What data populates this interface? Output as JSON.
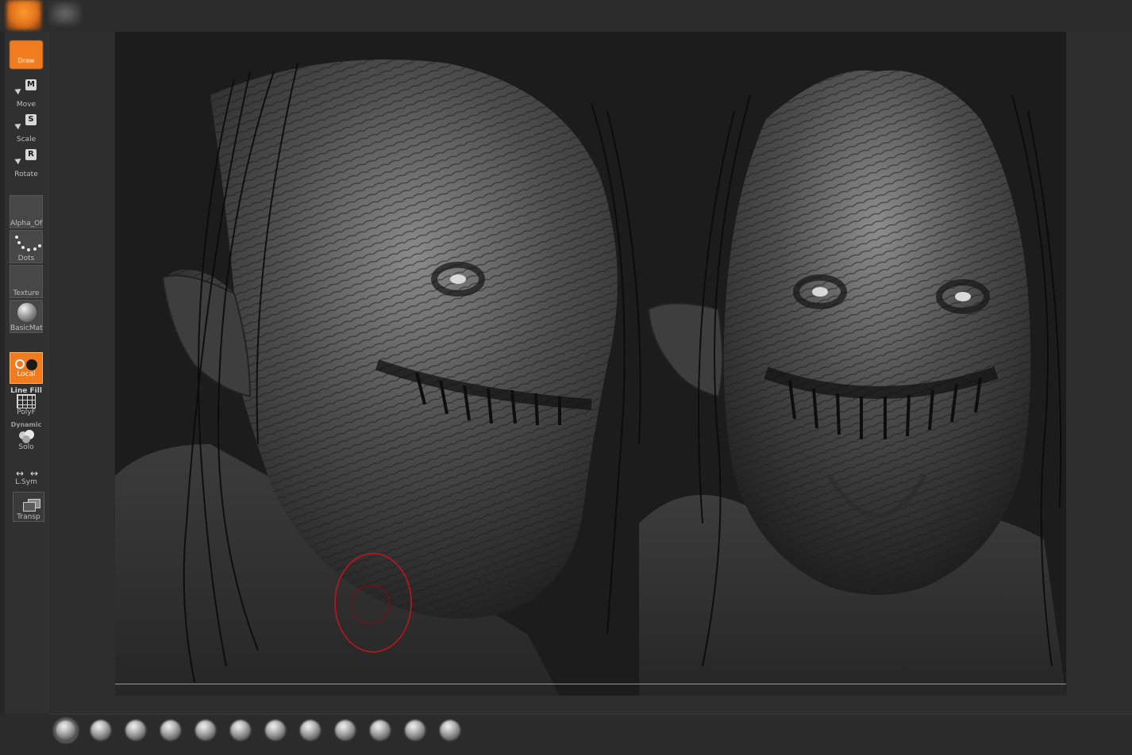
{
  "toolbar": {
    "draw_label": "Draw",
    "move_label": "Move",
    "move_key": "M",
    "scale_label": "Scale",
    "scale_key": "S",
    "rotate_label": "Rotate",
    "rotate_key": "R",
    "alpha_label": "Alpha_Of",
    "dots_label": "Dots",
    "texture_label": "Texture",
    "material_label": "BasicMat",
    "local_label": "Local",
    "linefill_label": "Line Fill",
    "polyf_label": "PolyF",
    "dynamic_label": "Dynamic",
    "solo_label": "Solo",
    "lsym_label": "L.Sym",
    "transp_label": "Transp"
  },
  "colors": {
    "accent": "#f07c1f",
    "background": "#2a2a2a",
    "canvas": "#1c1c1c",
    "brush_cursor": "#c0141a"
  },
  "brush_shelf": {
    "count": 12,
    "items": [
      "brush-1",
      "brush-2",
      "brush-3",
      "brush-4",
      "brush-5",
      "brush-6",
      "brush-7",
      "brush-8",
      "brush-9",
      "brush-10",
      "brush-11",
      "brush-12"
    ]
  }
}
